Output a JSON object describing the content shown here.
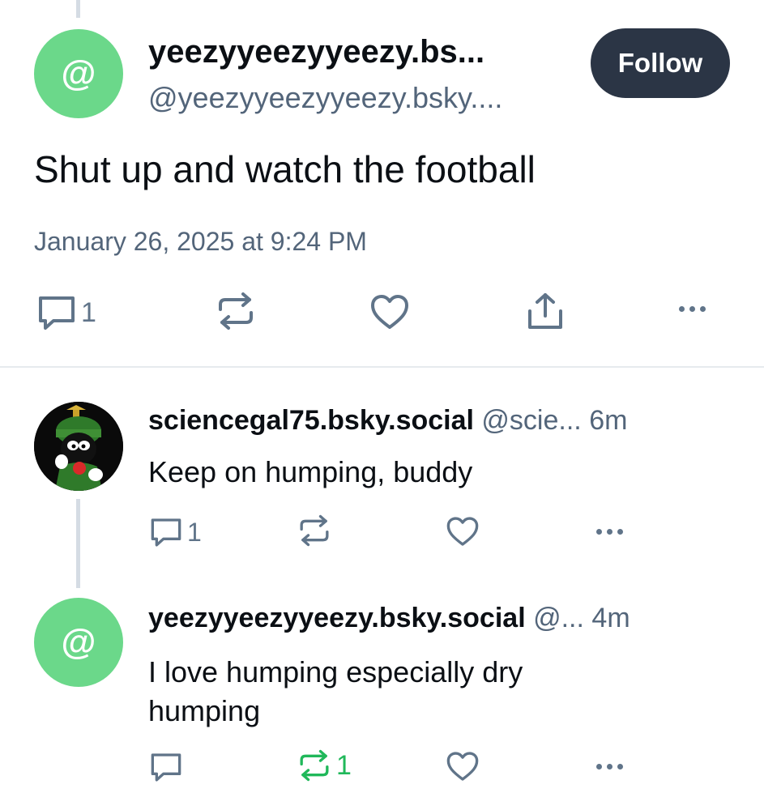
{
  "main_post": {
    "display_name": "yeezyyeezyyeezy.bs...",
    "handle": "@yeezyyeezyyeezy.bsky....",
    "follow_label": "Follow",
    "text": "Shut up and watch the football",
    "timestamp": "January 26, 2025 at 9:24 PM",
    "reply_count": "1",
    "avatar_glyph": "@"
  },
  "replies": [
    {
      "display_name": "sciencegal75.bsky.social",
      "handle": "@scie...",
      "time": "6m",
      "text": "Keep on humping, buddy",
      "reply_count": "1",
      "repost_count": ""
    },
    {
      "display_name": "yeezyyeezyyeezy.bsky.social",
      "handle": "@...",
      "time": "4m",
      "text_line1": "I love humping especially dry",
      "text_line2": "humping",
      "reply_count": "",
      "repost_count": "1",
      "avatar_glyph": "@"
    }
  ],
  "colors": {
    "avatar_green": "#6bd88a",
    "follow_bg": "#2b3545",
    "repost_active": "#20b85a",
    "muted": "#53657a"
  },
  "icons": [
    "comment-icon",
    "repost-icon",
    "heart-icon",
    "share-icon",
    "more-icon"
  ]
}
